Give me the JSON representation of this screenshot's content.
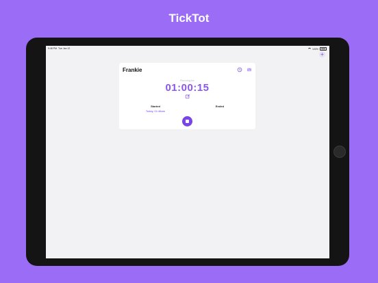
{
  "app_title": "TickTot",
  "status_bar": {
    "time": "9:48 PM",
    "date": "Tue Jan 12",
    "battery": "100%"
  },
  "toolbar": {
    "add_label": "+"
  },
  "timer_card": {
    "name": "Frankie",
    "status": "Running for",
    "elapsed": "01:00:15",
    "started_label": "Started",
    "started_value": "Today, 01:48am",
    "ended_label": "Ended",
    "ended_value": ""
  },
  "colors": {
    "background": "#9b6cf5",
    "accent": "#7a45e6",
    "timer_text": "#8a58e8"
  },
  "icons": [
    "history-icon",
    "stats-icon",
    "edit-icon",
    "stop-icon",
    "add-icon",
    "wifi-icon",
    "battery-icon"
  ]
}
